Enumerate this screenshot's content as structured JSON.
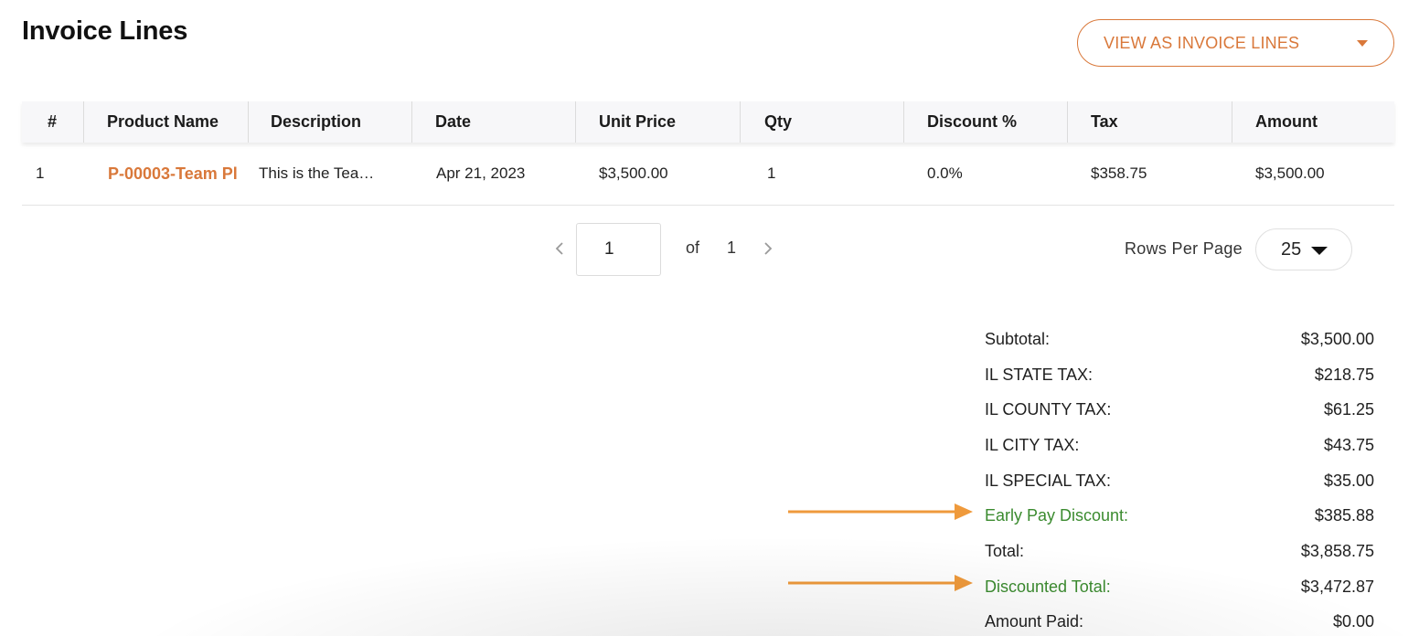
{
  "header": {
    "title": "Invoice Lines",
    "view_select": "VIEW AS INVOICE LINES"
  },
  "table": {
    "columns": [
      "#",
      "Product Name",
      "Description",
      "Date",
      "Unit Price",
      "Qty",
      "Discount %",
      "Tax",
      "Amount"
    ],
    "rows": [
      {
        "num": "1",
        "product": "P-00003-Team Pl",
        "description": "This is the Tea…",
        "date": "Apr 21, 2023",
        "unit_price": "$3,500.00",
        "qty": "1",
        "discount": "0.0%",
        "tax": "$358.75",
        "amount": "$3,500.00"
      }
    ]
  },
  "pagination": {
    "current_page": "1",
    "of_label": "of",
    "total_pages": "1",
    "rows_per_page_label": "Rows Per Page",
    "rows_per_page": "25"
  },
  "summary": [
    {
      "label": "Subtotal:",
      "value": "$3,500.00"
    },
    {
      "label": "IL STATE TAX:",
      "value": "$218.75"
    },
    {
      "label": "IL COUNTY TAX:",
      "value": "$61.25"
    },
    {
      "label": "IL CITY TAX:",
      "value": "$43.75"
    },
    {
      "label": "IL SPECIAL TAX:",
      "value": "$35.00"
    },
    {
      "label": "Early Pay Discount:",
      "value": "$385.88"
    },
    {
      "label": "Total:",
      "value": "$3,858.75"
    },
    {
      "label": "Discounted Total:",
      "value": "$3,472.87"
    },
    {
      "label": "Amount Paid:",
      "value": "$0.00"
    }
  ],
  "colors": {
    "accent": "#d9783a",
    "discount_green": "#3b8b2f",
    "annotation_arrow": "#ef9a3c"
  },
  "icons": {
    "view_select_caret": "caret-down-icon",
    "prev": "chevron-left-icon",
    "next": "chevron-right-icon",
    "rpp_caret": "caret-down-icon",
    "annotation": "arrow-right-icon"
  }
}
